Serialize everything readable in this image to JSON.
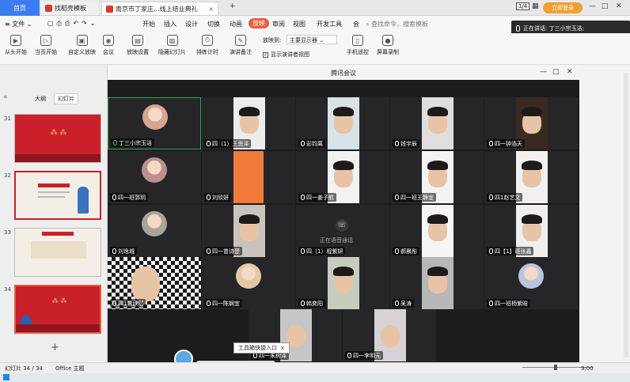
{
  "titlebar": {
    "home_tab": "首页",
    "tab1": "找稻壳模板",
    "tab2": "南京市丁家庄...线上结业典礼",
    "add_tab": "+",
    "page_indicator": "1/4",
    "login_label": "立即登录"
  },
  "menu": {
    "file": "文件",
    "items": [
      "开始",
      "插入",
      "设计",
      "切换",
      "动画",
      "放映",
      "审阅",
      "视图",
      "开发工具",
      "会"
    ],
    "active": "放映",
    "search_placeholder": "查找命令、搜索模板"
  },
  "ribbon": {
    "buttons": [
      "从头开始",
      "当页开始",
      "自定义放映",
      "会议",
      "放映设置",
      "隐藏幻灯片",
      "排练计时",
      "演讲备注"
    ],
    "show_on_label": "放映到:",
    "show_on_value": "主要显示器",
    "presenter_view": "显示演讲者视图",
    "handheld": "手机遥控",
    "record": "屏幕录制"
  },
  "speaking": "正在讲话: 丁三小宗玉洁;",
  "leftpanel": {
    "tab_outline": "大纲",
    "tab_slides": "幻灯片",
    "slide_numbers": [
      "31",
      "32",
      "33",
      "34"
    ],
    "add": "+"
  },
  "statusbar": {
    "slide_count": "幻灯片 34 / 34",
    "theme": "Office 主题"
  },
  "taskbar": {
    "time": "9:00"
  },
  "meeting": {
    "title": "腾讯会议",
    "tiles": [
      "丁三小宗玉洁",
      "四（1）王思泽",
      "彭钧离",
      "钱宇辰",
      "四一钟浩天",
      "四一班郭玥",
      "刘欣妍",
      "四一姜子航",
      "四一班王静宜",
      "四1赵艺文",
      "刘逸城",
      "四一苗诗楚",
      "四（1）程紫妍",
      "郝晨彤",
      "四【1】班张鑫",
      "四1曾欣然",
      "四一陈娴宜",
      "韩奕阳",
      "吴涛",
      "四一班杨紫晗",
      "四一朱树泽",
      "四一李明元"
    ],
    "call_tile_text": "正在语音通话"
  },
  "tip": "工具箱快捷入口",
  "tip_close": "×",
  "colors": {
    "accent": "#e85d3c",
    "home_tab": "#3d7bf0",
    "speaker_border": "#2fa84f"
  }
}
